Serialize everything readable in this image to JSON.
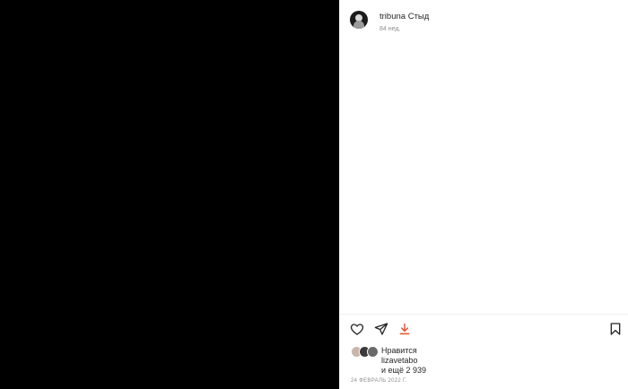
{
  "post": {
    "username": "tribuna",
    "caption": "Стыд",
    "time_ago": "84 нед."
  },
  "likes": {
    "label": "Нравится",
    "first_liker": "lizavetabo",
    "others": "и ещё 2 939"
  },
  "date": "24 ФЕВРАЛЬ 2022 Г.",
  "colors": {
    "media_background": "#000000",
    "download_icon": "#e0502e",
    "secondary_text": "#8e8e8e"
  },
  "icons": {
    "like": "heart-icon",
    "share": "send-icon",
    "download": "download-icon",
    "save": "bookmark-icon"
  }
}
